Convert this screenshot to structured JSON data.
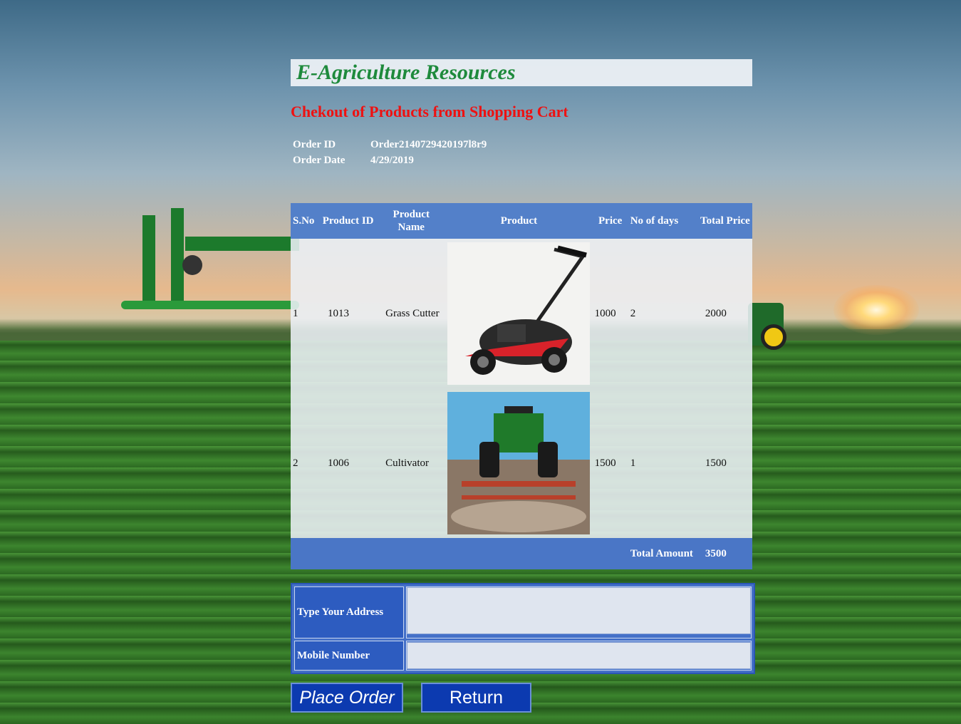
{
  "app": {
    "title": "E-Agriculture Resources"
  },
  "page": {
    "heading": "Chekout of Products from Shopping Cart"
  },
  "order": {
    "id_label": "Order ID",
    "id_value": "Order2140729420197l8r9",
    "date_label": "Order Date",
    "date_value": "4/29/2019"
  },
  "cart": {
    "headers": {
      "sno": "S.No",
      "product_id": "Product ID",
      "product_name": "Product Name",
      "product": "Product",
      "price": "Price",
      "days": "No of days",
      "total_price": "Total Price"
    },
    "rows": [
      {
        "sno": "1",
        "product_id": "1013",
        "product_name": "Grass Cutter",
        "image": "lawn-mower",
        "price": "1000",
        "days": "2",
        "total": "2000"
      },
      {
        "sno": "2",
        "product_id": "1006",
        "product_name": "Cultivator",
        "image": "tractor-cultivator",
        "price": "1500",
        "days": "1",
        "total": "1500"
      }
    ],
    "footer": {
      "total_label": "Total Amount",
      "total_value": "3500"
    }
  },
  "form": {
    "address_label": "Type Your Address",
    "address_value": "",
    "mobile_label": "Mobile Number",
    "mobile_value": ""
  },
  "buttons": {
    "place_order": "Place Order",
    "return": "Return"
  },
  "colors": {
    "title_green": "#1e8a3c",
    "heading_red": "#ee1111",
    "table_header_blue": "#5380c9",
    "button_blue": "#0c3ab0"
  }
}
